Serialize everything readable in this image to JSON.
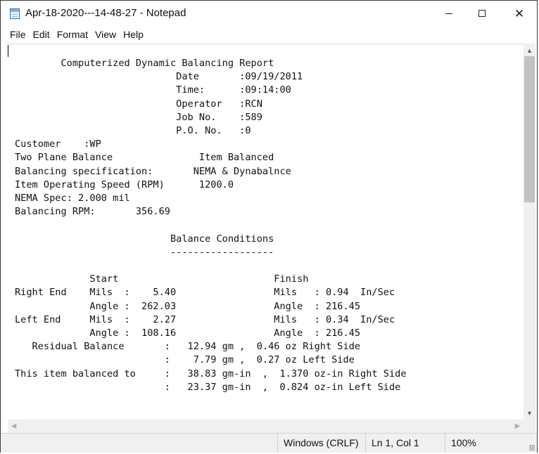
{
  "window": {
    "title": "Apr-18-2020---14-48-27 - Notepad",
    "controls": {
      "minimize": "—",
      "maximize": "☐",
      "close": "✕"
    }
  },
  "menu": [
    "File",
    "Edit",
    "Format",
    "View",
    "Help"
  ],
  "document": {
    "lines": [
      "        Computerized Dynamic Balancing Report",
      "                            Date       :09/19/2011",
      "                            Time:      :09:14:00",
      "                            Operator   :RCN",
      "                            Job No.    :589",
      "                            P.O. No.   :0",
      "Customer    :WP",
      "Two Plane Balance               Item Balanced",
      "Balancing specification:       NEMA & Dynabalnce",
      "Item Operating Speed (RPM)      1200.0",
      "NEMA Spec: 2.000 mil",
      "Balancing RPM:       356.69",
      "",
      "                           Balance Conditions",
      "                           ------------------",
      "",
      "             Start                           Finish",
      "Right End    Mils  :    5.40                 Mils   : 0.94  In/Sec",
      "             Angle :  262.03                 Angle  : 216.45",
      "Left End     Mils  :    2.27                 Mils   : 0.34  In/Sec",
      "             Angle :  108.16                 Angle  : 216.45",
      "   Residual Balance       :   12.94 gm ,  0.46 oz Right Side",
      "                          :    7.79 gm ,  0.27 oz Left Side",
      "This item balanced to     :   38.83 gm-in  ,  1.370 oz-in Right Side",
      "                          :   23.37 gm-in  ,  0.824 oz-in Left Side"
    ]
  },
  "status": {
    "encoding": "Windows (CRLF)",
    "position": "Ln 1, Col 1",
    "zoom": "100%"
  }
}
